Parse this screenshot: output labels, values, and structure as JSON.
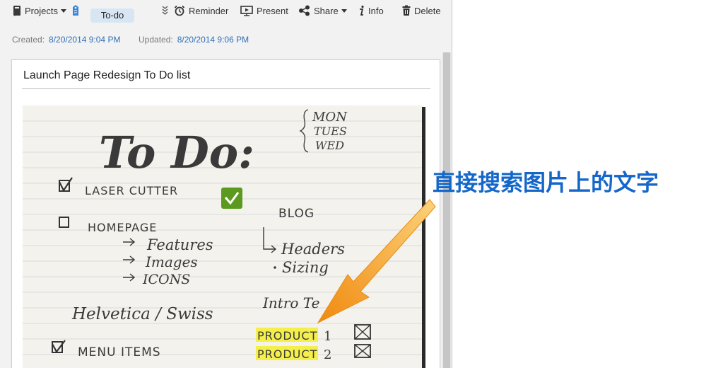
{
  "toolbar": {
    "projects_label": "Projects",
    "tag_label": "To-do",
    "reminder_label": "Reminder",
    "present_label": "Present",
    "share_label": "Share",
    "info_label": "Info",
    "delete_label": "Delete"
  },
  "meta": {
    "created_label": "Created:",
    "created_value": "8/20/2014 9:04 PM",
    "updated_label": "Updated:",
    "updated_value": "8/20/2014 9:06 PM"
  },
  "note": {
    "title": "Launch Page Redesign To Do list"
  },
  "handwriting": {
    "heading": "To Do:",
    "days": [
      "MON",
      "TUES",
      "WED"
    ],
    "laser_cutter": "LASER CUTTER",
    "homepage": "HOMEPAGE",
    "features": "Features",
    "images": "Images",
    "icons": "ICONS",
    "blog": "BLOG",
    "headers": "Headers",
    "sizing": "Sizing",
    "intro": "Intro Te",
    "helvetica": "Helvetica / Swiss",
    "product_1": "PRODUCT",
    "product_1_num": "1",
    "product_2": "PRODUCT",
    "product_2_num": "2",
    "menu_items": "MENU ITEMS"
  },
  "annotation": {
    "text": "直接搜索图片上的文字"
  },
  "colors": {
    "link_blue": "#2f6fb8",
    "tag_bg": "#d8e6f3",
    "annotation_blue": "#1467c9",
    "arrow_orange": "#f39a1e",
    "check_green": "#5b9a1e",
    "highlight_yellow": "#f4ef4a"
  }
}
